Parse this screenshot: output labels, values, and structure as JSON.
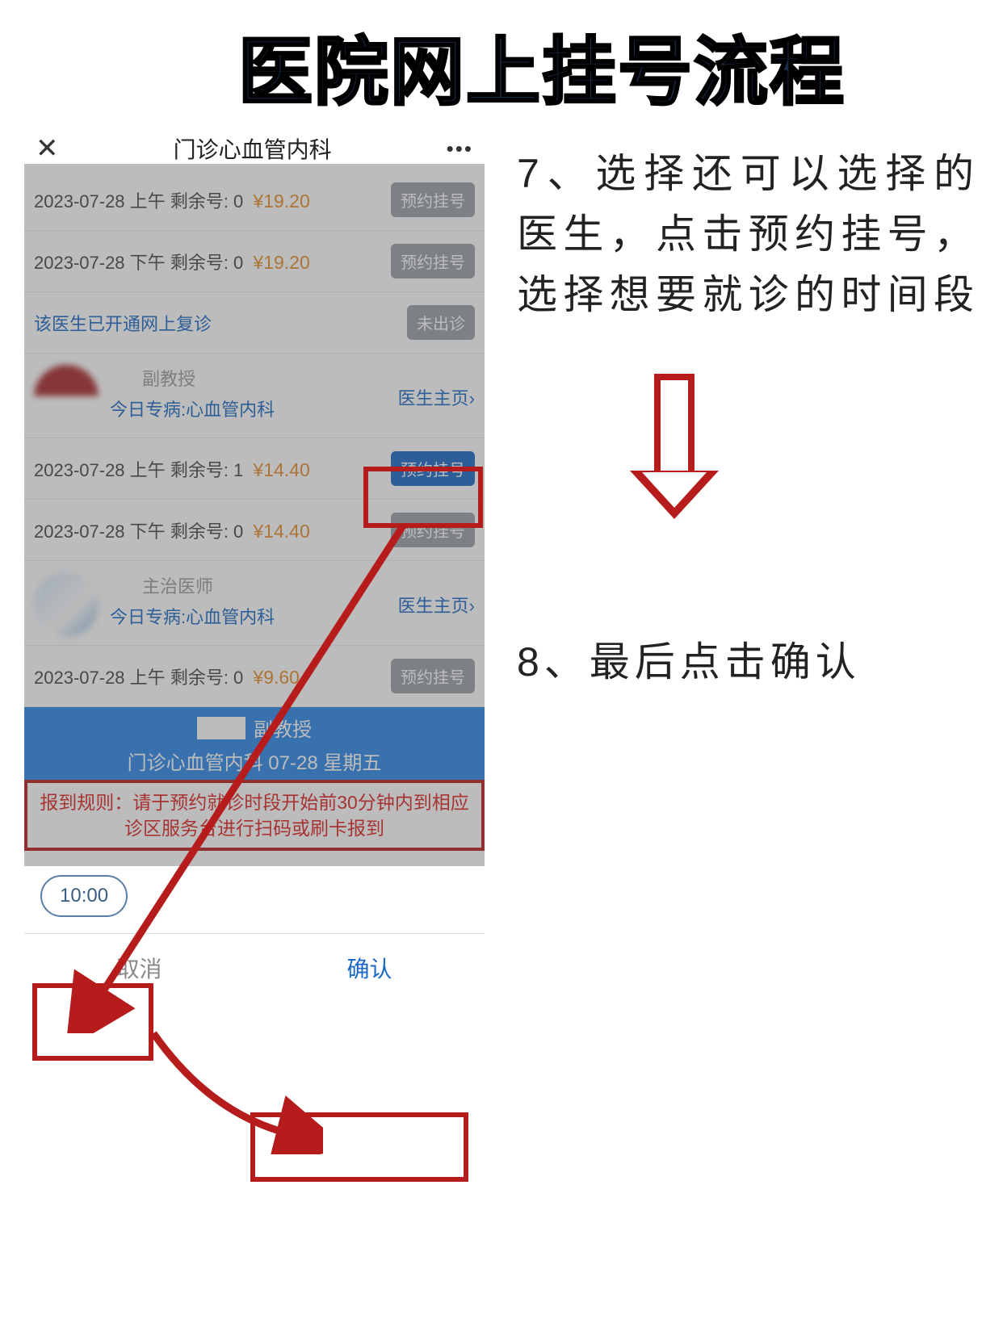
{
  "page_title": "医院网上挂号流程",
  "phone": {
    "header_title": "门诊心血管内科",
    "slots": [
      {
        "date": "2023-07-28",
        "period": "上午",
        "remain": "剩余号: 0",
        "price": "¥19.20",
        "btn": "预约挂号",
        "active": false
      },
      {
        "date": "2023-07-28",
        "period": "下午",
        "remain": "剩余号: 0",
        "price": "¥19.20",
        "btn": "预约挂号",
        "active": false
      }
    ],
    "online_followup": "该医生已开通网上复诊",
    "not_available": "未出诊",
    "doctor1": {
      "title": "副教授",
      "spec": "今日专病:心血管内科",
      "link": "医生主页"
    },
    "d1_slots": [
      {
        "date": "2023-07-28",
        "period": "上午",
        "remain": "剩余号: 1",
        "price": "¥14.40",
        "btn": "预约挂号",
        "active": true
      },
      {
        "date": "2023-07-28",
        "period": "下午",
        "remain": "剩余号: 0",
        "price": "¥14.40",
        "btn": "预约挂号",
        "active": false
      }
    ],
    "doctor2": {
      "title": "主治医师",
      "spec": "今日专病:心血管内科",
      "link": "医生主页"
    },
    "d2_slots": [
      {
        "date": "2023-07-28",
        "period": "上午",
        "remain": "剩余号: 0",
        "price": "¥9.60",
        "btn": "预约挂号",
        "active": false
      }
    ],
    "sheet": {
      "doc_title": "副教授",
      "dept_line": "门诊心血管内科  07-28  星期五",
      "rule": "报到规则：请于预约就诊时段开始前30分钟内到相应诊区服务台进行扫码或刷卡报到"
    },
    "time_slot": "10:00",
    "cancel": "取消",
    "confirm": "确认"
  },
  "steps": {
    "s7": "7、选择还可以选择的医生，点击预约挂号，选择想要就诊的时间段",
    "s8": "8、最后点击确认"
  }
}
